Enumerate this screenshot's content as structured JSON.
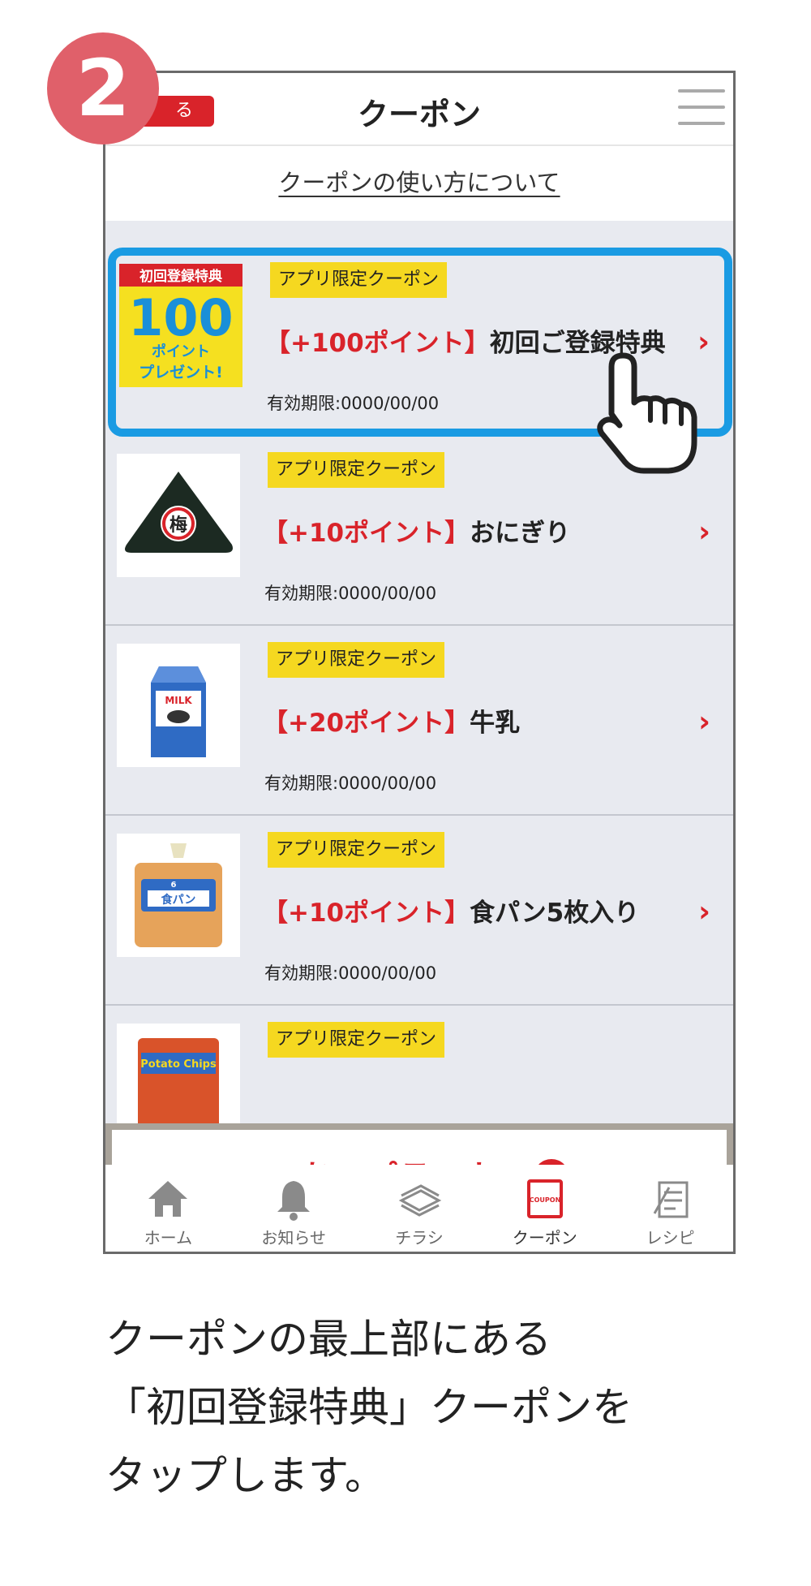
{
  "step": {
    "number": "2"
  },
  "header": {
    "back_label": "る",
    "title": "クーポン"
  },
  "howto_link": "クーポンの使い方について",
  "coupons": [
    {
      "tag": "アプリ限定クーポン",
      "points": "【+100ポイント】",
      "name": "初回ご登録特典",
      "expiry": "有効期限:0000/00/00",
      "thumb": {
        "type": "campaign",
        "label_top": "初回登録特典",
        "big": "100",
        "line1": "ポイント",
        "line2": "プレゼント!"
      }
    },
    {
      "tag": "アプリ限定クーポン",
      "points": "【+10ポイント】",
      "name": "おにぎり",
      "expiry": "有効期限:0000/00/00",
      "thumb": {
        "type": "onigiri",
        "label": "梅"
      }
    },
    {
      "tag": "アプリ限定クーポン",
      "points": "【+20ポイント】",
      "name": "牛乳",
      "expiry": "有効期限:0000/00/00",
      "thumb": {
        "type": "milk",
        "label": "MILK"
      }
    },
    {
      "tag": "アプリ限定クーポン",
      "points": "【+10ポイント】",
      "name": "食パン5枚入り",
      "expiry": "有効期限:0000/00/00",
      "thumb": {
        "type": "bread",
        "label": "食パン",
        "count": "6"
      }
    },
    {
      "tag": "アプリ限定クーポン",
      "points": "",
      "name": "",
      "expiry": "",
      "thumb": {
        "type": "chips",
        "label": "Potato Chips"
      }
    }
  ],
  "card_banner": {
    "label": "あいプラスカード"
  },
  "tabs": [
    {
      "label": "ホーム",
      "icon": "home-icon"
    },
    {
      "label": "お知らせ",
      "icon": "bell-icon"
    },
    {
      "label": "チラシ",
      "icon": "flyer-icon"
    },
    {
      "label": "クーポン",
      "icon": "coupon-icon",
      "icon_text": "COUPON"
    },
    {
      "label": "レシピ",
      "icon": "recipe-icon"
    }
  ],
  "instruction": {
    "line1": "クーポンの最上部にある",
    "line2": "「初回登録特典」クーポンを",
    "line3": "タップします。"
  },
  "colors": {
    "accent_red": "#d9232a",
    "highlight_blue": "#1a9be3",
    "tag_yellow": "#f5d820",
    "step_badge": "#e0606a"
  }
}
